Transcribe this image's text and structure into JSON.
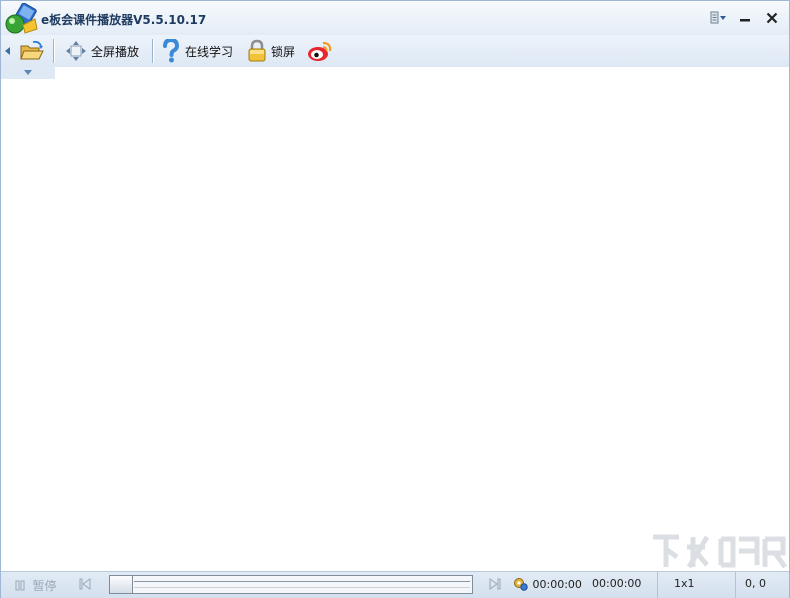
{
  "window": {
    "title": "e板会课件播放器V5.5.10.17"
  },
  "titlebar": {
    "menu_icon": "menu-dropdown-icon",
    "minimize_icon": "minimize-icon",
    "close_icon": "close-icon"
  },
  "toolbar": {
    "open_icon": "folder-open-icon",
    "fullscreen_label": "全屏播放",
    "online_label": "在线学习",
    "lock_label": "锁屏",
    "weibo_icon": "weibo-icon"
  },
  "statusbar": {
    "pause_label": "暂停",
    "progress": 0,
    "time_current": "00:00:00",
    "time_total": "00:00:00",
    "zoom": "1x1",
    "coords": "0, 0"
  },
  "colors": {
    "accent": "#1e3a5f",
    "content_bg": "#ffffff",
    "chrome_bg": "#e7eff8"
  }
}
